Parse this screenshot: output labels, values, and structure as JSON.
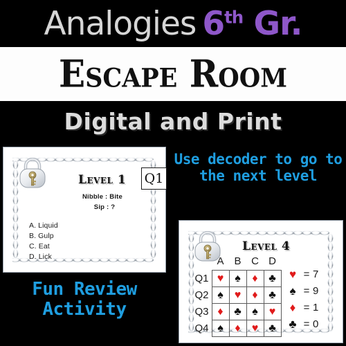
{
  "header": {
    "title_main": "Analogies",
    "grade_number": "6",
    "grade_sup": "th",
    "grade_suffix": " Gr.",
    "escape_room": "Escape Room",
    "subtitle": "Digital and Print",
    "accent_purple": "#8e57c9",
    "accent_blue": "#1f9ee0",
    "title_gray": "#d6d6d6"
  },
  "worksheet": {
    "lock_icon": "padlock-with-key-icon",
    "level_label": "Level 1",
    "question_badge": "Q1",
    "analogy_line1": "Nibble : Bite",
    "analogy_line2": "Sip :   ?",
    "options": [
      "A. Liquid",
      "B. Gulp",
      "C. Eat",
      "D. Lick"
    ]
  },
  "decoder_hint": "Use decoder to go to the next level",
  "fun_review": "Fun Review Activity",
  "decoder": {
    "lock_icon": "padlock-with-key-icon",
    "level_label": "Level 4",
    "column_headers": [
      "A",
      "B",
      "C",
      "D"
    ],
    "row_headers": [
      "Q1",
      "Q2",
      "Q3",
      "Q4"
    ],
    "grid": [
      [
        {
          "suit": "heart",
          "color": "red"
        },
        {
          "suit": "spade",
          "color": "black"
        },
        {
          "suit": "diamond",
          "color": "red"
        },
        {
          "suit": "club",
          "color": "black"
        }
      ],
      [
        {
          "suit": "spade",
          "color": "black"
        },
        {
          "suit": "heart",
          "color": "red"
        },
        {
          "suit": "diamond",
          "color": "red"
        },
        {
          "suit": "club",
          "color": "black"
        }
      ],
      [
        {
          "suit": "diamond",
          "color": "red"
        },
        {
          "suit": "club",
          "color": "black"
        },
        {
          "suit": "spade",
          "color": "black"
        },
        {
          "suit": "heart",
          "color": "red"
        }
      ],
      [
        {
          "suit": "spade",
          "color": "black"
        },
        {
          "suit": "diamond",
          "color": "red"
        },
        {
          "suit": "heart",
          "color": "red"
        },
        {
          "suit": "club",
          "color": "black"
        }
      ]
    ],
    "legend": [
      {
        "suit": "heart",
        "color": "red",
        "equals": "=",
        "value": "7"
      },
      {
        "suit": "spade",
        "color": "black",
        "equals": "=",
        "value": "9"
      },
      {
        "suit": "diamond",
        "color": "red",
        "equals": "=",
        "value": "1"
      },
      {
        "suit": "club",
        "color": "black",
        "equals": "=",
        "value": "0"
      }
    ]
  },
  "glyphs": {
    "heart": "♥",
    "spade": "♠",
    "diamond": "♦",
    "club": "♣"
  },
  "colors": {
    "suit_red": "#e01b1b",
    "suit_black": "#111111",
    "card_bg": "#ffffff",
    "page_bg": "#000000"
  }
}
